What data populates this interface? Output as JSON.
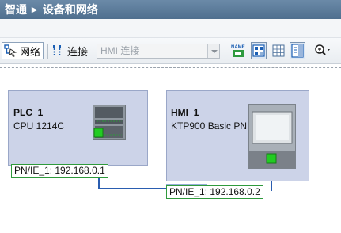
{
  "titlebar": {
    "project": "智通",
    "section": "设备和网络"
  },
  "toolbar": {
    "network_label": "网络",
    "connect_label": "连接",
    "connection_type": "HMI 连接",
    "icons": [
      "network-view-icon",
      "connection-icon",
      "show-names-icon",
      "layout-toggle-icon",
      "grid-icon",
      "sidebar-toggle-icon",
      "zoom-icon"
    ]
  },
  "devices": [
    {
      "name": "PLC_1",
      "type": "CPU 1214C",
      "interface": "PN/IE_1: 192.168.0.1"
    },
    {
      "name": "HMI_1",
      "type": "KTP900 Basic PN",
      "interface": "PN/IE_1: 192.168.0.2"
    }
  ],
  "colors": {
    "device_bg": "#ccd3e8",
    "network_line": "#2a5db0",
    "port": "#22cc22",
    "title_bar": "#5a7a99"
  }
}
